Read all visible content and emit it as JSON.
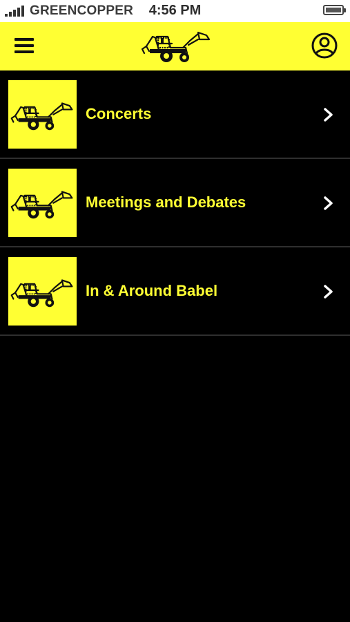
{
  "status_bar": {
    "carrier": "GREENCOPPER",
    "time": "4:56 PM",
    "signal_icon": "signal-bars-icon",
    "battery_icon": "battery-icon"
  },
  "top_bar": {
    "background_color": "#ffff33",
    "menu_icon": "hamburger-menu-icon",
    "logo_icon": "backhoe-loader-logo",
    "profile_icon": "user-profile-icon"
  },
  "categories": [
    {
      "label": "Concerts",
      "thumbnail_icon": "backhoe-loader-thumbnail",
      "chevron_icon": "chevron-right-icon"
    },
    {
      "label": "Meetings and Debates",
      "thumbnail_icon": "backhoe-loader-thumbnail",
      "chevron_icon": "chevron-right-icon"
    },
    {
      "label": "In & Around Babel",
      "thumbnail_icon": "backhoe-loader-thumbnail",
      "chevron_icon": "chevron-right-icon"
    }
  ],
  "colors": {
    "accent_yellow": "#ffff33",
    "background": "#000000",
    "divider": "#2f2f2f"
  }
}
